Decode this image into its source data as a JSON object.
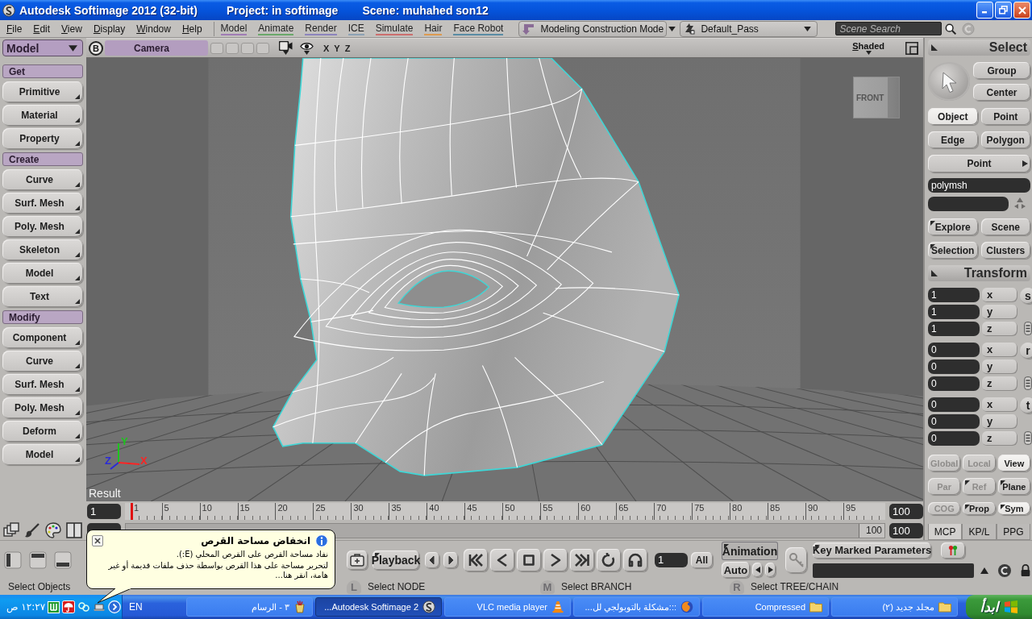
{
  "window": {
    "title": "Autodesk Softimage 2012 (32-bit)",
    "project": "Project: in softimage",
    "scene": "Scene: muhahed son12"
  },
  "menu": {
    "items": [
      "File",
      "Edit",
      "View",
      "Display",
      "Window",
      "Help"
    ],
    "modules": [
      {
        "label": "Model",
        "color": "#a07cb4"
      },
      {
        "label": "Animate",
        "color": "#6aa86a"
      },
      {
        "label": "Render",
        "color": "#8c84bc"
      },
      {
        "label": "ICE",
        "color": "#8ca2b4"
      },
      {
        "label": "Simulate",
        "color": "#cc6e6e"
      },
      {
        "label": "Hair",
        "color": "#dc9a50"
      },
      {
        "label": "Face Robot",
        "color": "#5a8ca4"
      }
    ],
    "mode": "Modeling Construction Mode",
    "pass": "Default_Pass",
    "search": {
      "placeholder": "Scene Search"
    }
  },
  "left_panel": {
    "module": "Model",
    "sections": [
      {
        "title": "Get",
        "buttons": [
          "Primitive",
          "Material",
          "Property"
        ]
      },
      {
        "title": "Create",
        "buttons": [
          "Curve",
          "Surf. Mesh",
          "Poly. Mesh",
          "Skeleton",
          "Model",
          "Text"
        ]
      },
      {
        "title": "Modify",
        "buttons": [
          "Component",
          "Curve",
          "Surf. Mesh",
          "Poly. Mesh",
          "Deform",
          "Model"
        ]
      }
    ]
  },
  "viewport": {
    "view": "B",
    "camera": "Camera",
    "axes": [
      "X",
      "Y",
      "Z"
    ],
    "display_mode": "Shaded",
    "cube": "FRONT",
    "label": "Result",
    "gizmo": [
      {
        "axis": "Y",
        "color": "#1ec41e"
      },
      {
        "axis": "Z",
        "color": "#2a2ad8"
      },
      {
        "axis": "X",
        "color": "#ff2424"
      }
    ]
  },
  "right_panel": {
    "select": {
      "title": "Select",
      "tools": [
        "Group",
        "Center"
      ],
      "filters": [
        {
          "label": "Object",
          "selected": true
        },
        {
          "label": "Point",
          "selected": false
        },
        {
          "label": "Edge",
          "selected": false
        },
        {
          "label": "Polygon",
          "selected": false
        }
      ],
      "component": "Point",
      "type": "polymsh",
      "browse": [
        {
          "label": "Explore",
          "menu": true
        },
        {
          "label": "Scene",
          "menu": false
        },
        {
          "label": "Selection",
          "menu": true
        },
        {
          "label": "Clusters",
          "menu": false
        }
      ]
    },
    "transform": {
      "title": "Transform",
      "groups": [
        {
          "label": "s",
          "values": [
            {
              "axis": "x",
              "value": "1"
            },
            {
              "axis": "y",
              "value": "1"
            },
            {
              "axis": "z",
              "value": "1"
            }
          ]
        },
        {
          "label": "r",
          "values": [
            {
              "axis": "x",
              "value": "0"
            },
            {
              "axis": "y",
              "value": "0"
            },
            {
              "axis": "z",
              "value": "0"
            }
          ]
        },
        {
          "label": "t",
          "values": [
            {
              "axis": "x",
              "value": "0"
            },
            {
              "axis": "y",
              "value": "0"
            },
            {
              "axis": "z",
              "value": "0"
            }
          ]
        }
      ],
      "reference": [
        {
          "label": "Global",
          "disabled": true,
          "selected": false,
          "menu": false
        },
        {
          "label": "Local",
          "disabled": true,
          "selected": false,
          "menu": false
        },
        {
          "label": "View",
          "disabled": false,
          "selected": true,
          "menu": false
        },
        {
          "label": "Par",
          "disabled": true,
          "selected": false,
          "menu": false
        },
        {
          "label": "Ref",
          "disabled": true,
          "selected": false,
          "menu": true
        },
        {
          "label": "Plane",
          "disabled": false,
          "selected": false,
          "menu": true
        }
      ],
      "options": [
        {
          "label": "COG",
          "disabled": true,
          "selected": false,
          "menu": false
        },
        {
          "label": "Prop",
          "disabled": false,
          "selected": false,
          "menu": true
        },
        {
          "label": "Sym",
          "disabled": false,
          "selected": true,
          "menu": true
        }
      ]
    },
    "tabs": [
      {
        "label": "MCP",
        "selected": true
      },
      {
        "label": "KP/L",
        "selected": false
      },
      {
        "label": "PPG",
        "selected": false
      }
    ]
  },
  "timeline": {
    "start": "1",
    "end": "100",
    "ticks": [
      "1",
      "5",
      "10",
      "15",
      "20",
      "25",
      "30",
      "35",
      "40",
      "45",
      "50",
      "55",
      "60",
      "65",
      "70",
      "75",
      "80",
      "85",
      "90",
      "95"
    ],
    "playhead": {
      "level": 0
    },
    "range_handle": "100",
    "range_end": "100"
  },
  "playback_bar": {
    "playback": "Playback",
    "frame": "1",
    "range": "All",
    "animation": "Animation",
    "auto": "Auto",
    "keying": "Key Marked Parameters"
  },
  "status_bar": {
    "message": "Select Objects",
    "mouse": [
      {
        "button": "L",
        "action": "Select NODE"
      },
      {
        "button": "M",
        "action": "Select BRANCH"
      },
      {
        "button": "R",
        "action": "Select TREE/CHAIN"
      }
    ]
  },
  "notification": {
    "title": "انخفاض مساحة القرص",
    "lines": [
      "نفاد مساحة القرص على القرص المحلي (E:).",
      "لتحرير مساحة على هذا القرص بواسطة حذف ملفات قديمة أو غير هامة، انقر هنا..."
    ]
  },
  "taskbar": {
    "clock": "١٢:٢٧ ص",
    "language": "EN",
    "tasks": [
      {
        "label": "٣ - الرسام",
        "kind": "paint",
        "selected": false
      },
      {
        "label": "Autodesk Softimage 2...",
        "kind": "app",
        "selected": true
      },
      {
        "label": "VLC media player",
        "kind": "player",
        "selected": false
      },
      {
        "label": ":::مشكلة بالتوبولجي لل...",
        "kind": "browser",
        "selected": false
      },
      {
        "label": "Compressed",
        "kind": "folder",
        "selected": false
      },
      {
        "label": "مجلد جديد (٢)",
        "kind": "folder",
        "selected": false
      }
    ],
    "start": "ابدأ"
  }
}
